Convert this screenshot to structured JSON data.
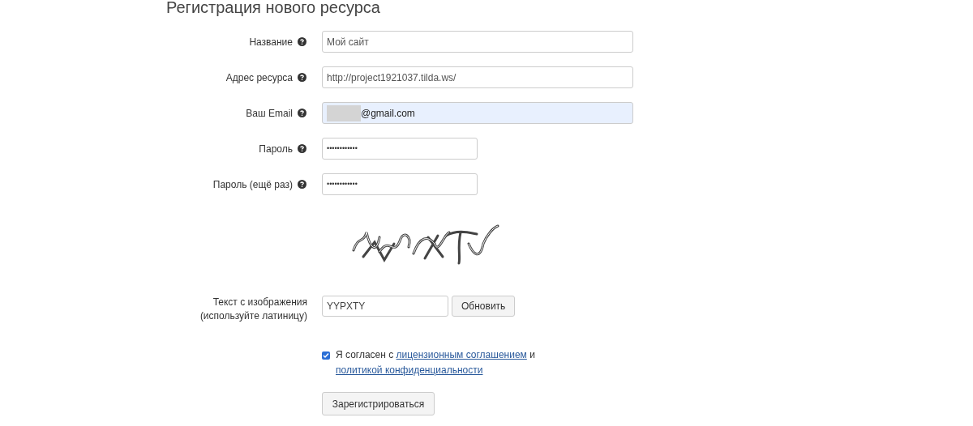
{
  "title": "Регистрация нового ресурса",
  "fields": [
    {
      "label": "Название",
      "kind": "text",
      "value": "Мой сайт",
      "autofilled": false,
      "redacted": false
    },
    {
      "label": "Адрес ресурса",
      "kind": "text",
      "value": "http://project1921037.tilda.ws/",
      "autofilled": false,
      "redacted": false
    },
    {
      "label": "Ваш Email",
      "kind": "text",
      "value": "@gmail.com",
      "autofilled": true,
      "redacted": true
    },
    {
      "label": "Пароль",
      "kind": "password",
      "value": "••••••••••••",
      "autofilled": false,
      "redacted": false
    },
    {
      "label": "Пароль (ещё раз)",
      "kind": "password",
      "value": "••••••••••••",
      "autofilled": false,
      "redacted": false
    }
  ],
  "captcha": {
    "kind": "picture",
    "label_lines": [
      "Текст с изображения",
      "(используйте латиницу)"
    ],
    "value": "YYPXTY",
    "refresh_button": "Обновить"
  },
  "agreement": {
    "checked": true,
    "text_before": "Я согласен с",
    "link_1": "лицензионным соглашением",
    "text_middle": "и",
    "link_2": "политикой конфиденциальности"
  },
  "submit_button": "Зарегистрироваться"
}
